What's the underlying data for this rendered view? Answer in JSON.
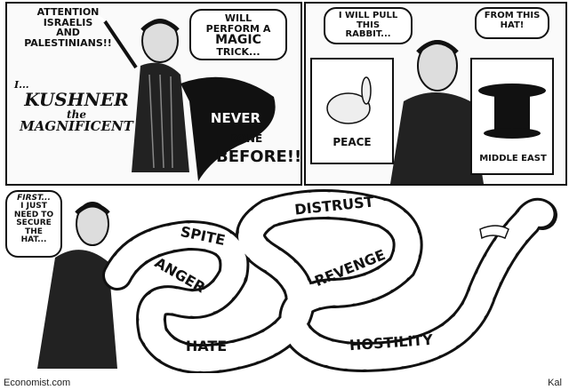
{
  "panel1": {
    "attention": [
      "ATTENTION",
      "ISRAELIS",
      "AND",
      "PALESTINIANS!!"
    ],
    "intro": "I...",
    "title_name": "KUSHNER",
    "title_the": "the",
    "title_magnificent": "MAGNIFICENT",
    "will_perform": [
      "WILL PERFORM A",
      "MAGIC",
      "TRICK..."
    ],
    "cape_never": "NEVER",
    "cape_done": "DONE",
    "cape_before": "BEFORE!!"
  },
  "panel2": {
    "bubble_left": [
      "I WILL PULL",
      "THIS",
      "RABBIT..."
    ],
    "bubble_right": [
      "FROM THIS",
      "HAT!"
    ],
    "sign_peace": "PEACE",
    "sign_middle_east": "MIDDLE EAST"
  },
  "panel3": {
    "bubble": [
      "FIRST...",
      "I JUST",
      "NEED TO",
      "SECURE",
      "THE",
      "HAT..."
    ],
    "snake_words": {
      "spite": "SPITE",
      "anger": "ANGER",
      "hate": "HATE",
      "distrust": "DISTRUST",
      "revenge": "REVENGE",
      "hostility": "HOSTILITY"
    }
  },
  "footer": {
    "source": "Economist.com",
    "signature": "Kal"
  }
}
